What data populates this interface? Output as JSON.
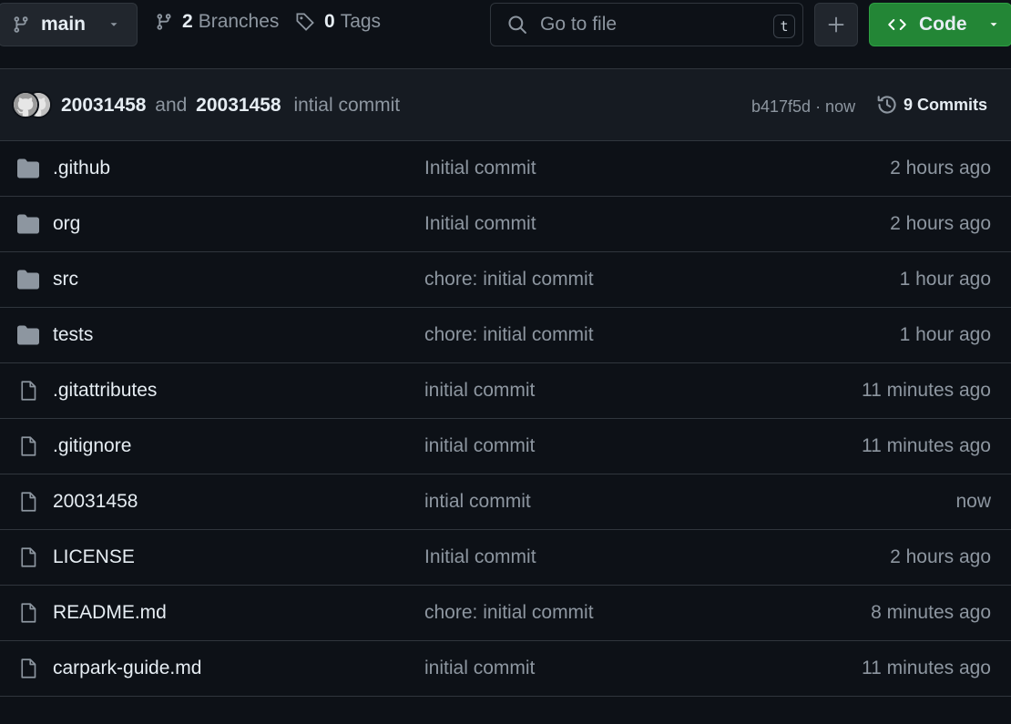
{
  "toolbar": {
    "branch": "main",
    "branches_count": "2",
    "branches_label": "Branches",
    "tags_count": "0",
    "tags_label": "Tags",
    "search_placeholder": "Go to file",
    "search_shortcut": "t",
    "code_label": "Code"
  },
  "commit": {
    "author1": "20031458",
    "and_text": "and",
    "author2": "20031458",
    "message": "intial commit",
    "sha": "b417f5d · now",
    "commits_label": "9 Commits"
  },
  "files": [
    {
      "type": "folder",
      "name": ".github",
      "message": "Initial commit",
      "age": "2 hours ago"
    },
    {
      "type": "folder",
      "name": "org",
      "message": "Initial commit",
      "age": "2 hours ago"
    },
    {
      "type": "folder",
      "name": "src",
      "message": "chore: initial commit",
      "age": "1 hour ago"
    },
    {
      "type": "folder",
      "name": "tests",
      "message": "chore: initial commit",
      "age": "1 hour ago"
    },
    {
      "type": "file",
      "name": ".gitattributes",
      "message": "initial commit",
      "age": "11 minutes ago"
    },
    {
      "type": "file",
      "name": ".gitignore",
      "message": "initial commit",
      "age": "11 minutes ago"
    },
    {
      "type": "file",
      "name": "20031458",
      "message": "intial commit",
      "age": "now"
    },
    {
      "type": "file",
      "name": "LICENSE",
      "message": "Initial commit",
      "age": "2 hours ago"
    },
    {
      "type": "file",
      "name": "README.md",
      "message": "chore: initial commit",
      "age": "8 minutes ago"
    },
    {
      "type": "file",
      "name": "carpark-guide.md",
      "message": "initial commit",
      "age": "11 minutes ago"
    }
  ],
  "colors": {
    "background": "#0d1117",
    "header_bg": "#161b22",
    "border": "#30363d",
    "muted": "#8d96a0",
    "code_button": "#238636",
    "folder_icon": "#8d96a0"
  }
}
